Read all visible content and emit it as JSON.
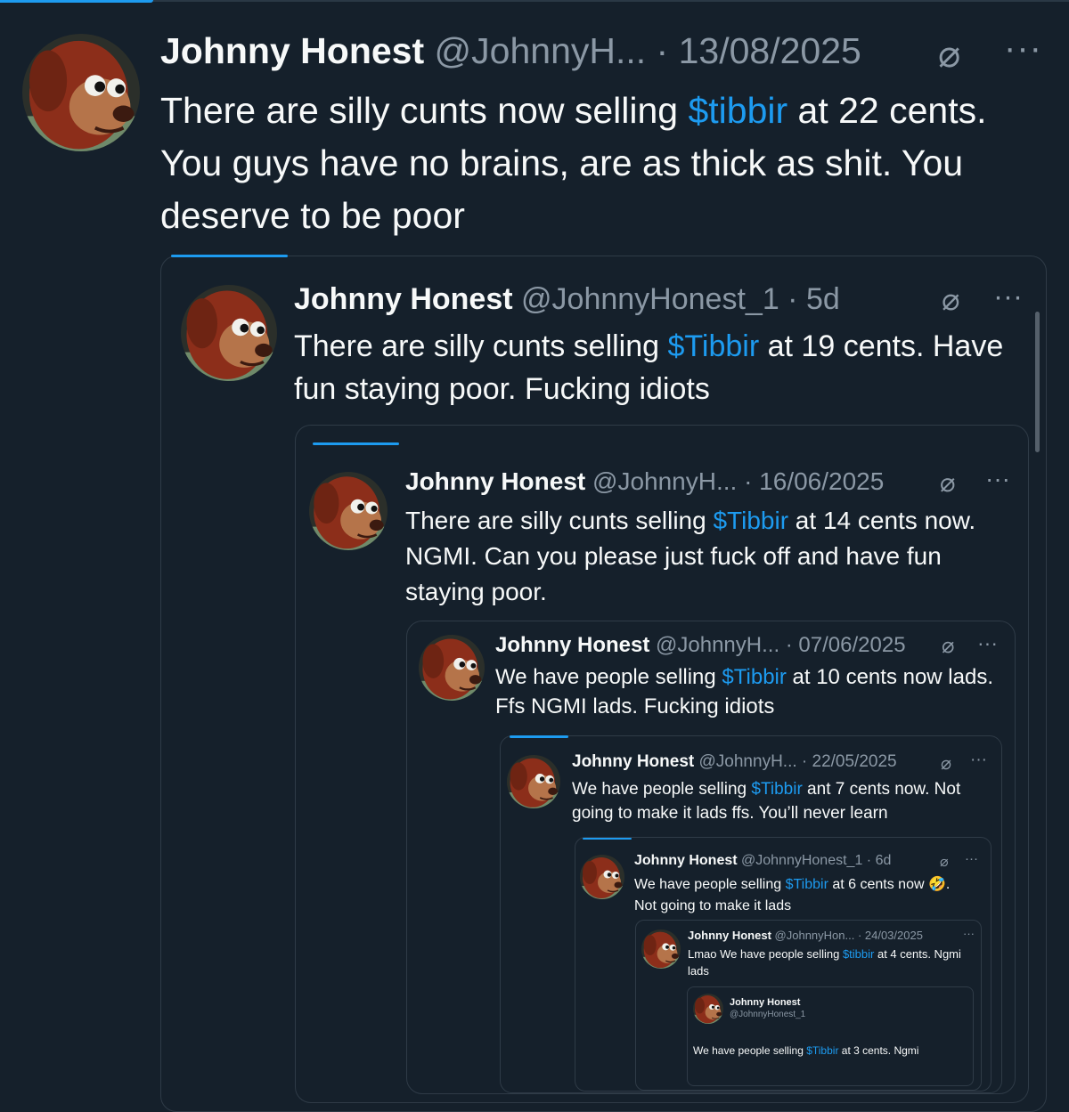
{
  "icons": {
    "grok": "grok-icon",
    "more": "more-icon"
  },
  "colors": {
    "background": "#15202b",
    "link": "#1d9bf0",
    "muted": "#8b98a5",
    "border": "#2f3b47"
  },
  "tweets": [
    {
      "name": "Johnny Honest",
      "handle_date": "@JohnnyH... · 13/08/2025",
      "text": [
        "There are silly cunts now selling ",
        "$tibbir",
        " at 22 cents. You guys have no brains, are as thick as shit. You deserve to be poor"
      ]
    },
    {
      "name": "Johnny Honest",
      "handle_date": "@JohnnyHonest_1 · 5d",
      "text": [
        "There are silly cunts selling ",
        "$Tibbir",
        " at 19 cents. Have fun staying poor. Fucking idiots"
      ]
    },
    {
      "name": "Johnny Honest",
      "handle_date": "@JohnnyH... · 16/06/2025",
      "text": [
        "There are silly cunts selling ",
        "$Tibbir",
        " at 14 cents now. NGMI. Can you please just fuck off and have fun staying poor."
      ]
    },
    {
      "name": "Johnny Honest",
      "handle_date": "@JohnnyH... · 07/06/2025",
      "text": [
        "We have people selling ",
        "$Tibbir",
        " at 10 cents now lads. Ffs  NGMI lads. Fucking idiots"
      ]
    },
    {
      "name": "Johnny Honest",
      "handle_date": "@JohnnyH... · 22/05/2025",
      "text": [
        "We have people selling ",
        "$Tibbir",
        " ant 7 cents now. Not going to make it lads ffs. You’ll never learn"
      ]
    },
    {
      "name": "Johnny Honest",
      "handle_date": "@JohnnyHonest_1 · 6d",
      "text": [
        "We have people selling ",
        "$Tibbir",
        " at 6 cents now 🤣. Not going to make it lads"
      ]
    },
    {
      "name": "Johnny Honest",
      "handle_date": "@JohnnyHon... · 24/03/2025",
      "text": [
        "Lmao We have people selling ",
        "$tibbir",
        " at 4 cents. Ngmi lads"
      ]
    },
    {
      "name": "Johnny Honest",
      "handle": "@JohnnyHonest_1",
      "text": [
        "We have people selling ",
        "$Tibbir",
        " at 3 cents. Ngmi"
      ]
    }
  ]
}
